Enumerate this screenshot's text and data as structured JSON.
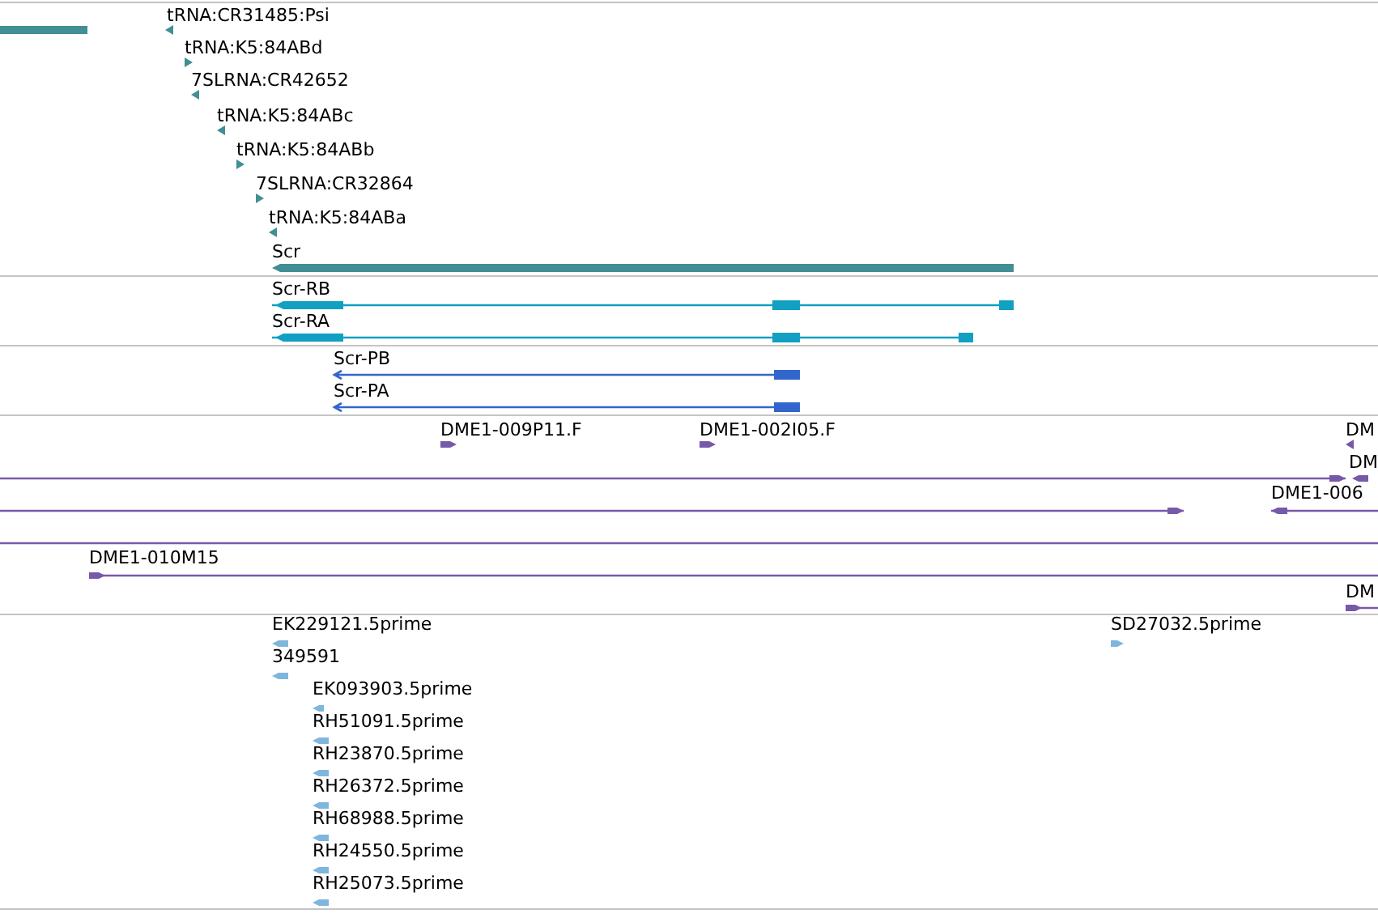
{
  "tracks": [
    {
      "color": "#3f8f94",
      "features": [
        {
          "kind": "bar"
        },
        {
          "kind": "marker",
          "label": "tRNA:CR31485:Psi",
          "reverse": true
        },
        {
          "kind": "marker",
          "label": "tRNA:K5:84ABd",
          "reverse": false
        },
        {
          "kind": "marker",
          "label": "7SLRNA:CR42652",
          "reverse": true
        },
        {
          "kind": "marker",
          "label": "tRNA:K5:84ABc",
          "reverse": true
        },
        {
          "kind": "marker",
          "label": "tRNA:K5:84ABb",
          "reverse": false
        },
        {
          "kind": "marker",
          "label": "7SLRNA:CR32864",
          "reverse": false
        },
        {
          "kind": "marker",
          "label": "tRNA:K5:84ABa",
          "reverse": true
        },
        {
          "kind": "bar",
          "label": "Scr",
          "reverse": true
        }
      ]
    },
    {
      "color": "#11a0c2",
      "features": [
        {
          "kind": "transcript",
          "label": "Scr-RB",
          "reverse": true
        },
        {
          "kind": "transcript",
          "label": "Scr-RA",
          "reverse": true
        }
      ]
    },
    {
      "color": "#3366cc",
      "features": [
        {
          "kind": "transcript",
          "label": "Scr-PB",
          "reverse": true
        },
        {
          "kind": "transcript",
          "label": "Scr-PA",
          "reverse": true
        }
      ]
    },
    {
      "color": "#7759aa",
      "features": [
        {
          "kind": "marker",
          "label": "DME1-009P11.F",
          "reverse": false
        },
        {
          "kind": "marker",
          "label": "DME1-002I05.F",
          "reverse": false
        },
        {
          "kind": "marker",
          "label": "DM",
          "reverse": true
        },
        {
          "kind": "line",
          "reverse": false
        },
        {
          "kind": "marker",
          "label": "DM",
          "reverse": true
        },
        {
          "kind": "line",
          "reverse": false
        },
        {
          "kind": "line",
          "label": "DME1-006",
          "reverse": true
        },
        {
          "kind": "line"
        },
        {
          "kind": "line",
          "label": "DME1-010M15",
          "reverse": false
        },
        {
          "kind": "line",
          "label": "DM",
          "reverse": false
        }
      ]
    },
    {
      "color": "#7fb6dc",
      "features": [
        {
          "kind": "marker",
          "label": "EK229121.5prime",
          "reverse": true
        },
        {
          "kind": "marker",
          "label": "SD27032.5prime",
          "reverse": false
        },
        {
          "kind": "marker",
          "label": "349591",
          "reverse": true
        },
        {
          "kind": "marker",
          "label": "EK093903.5prime",
          "reverse": true
        },
        {
          "kind": "marker",
          "label": "RH51091.5prime",
          "reverse": true
        },
        {
          "kind": "marker",
          "label": "RH23870.5prime",
          "reverse": true
        },
        {
          "kind": "marker",
          "label": "RH26372.5prime",
          "reverse": true
        },
        {
          "kind": "marker",
          "label": "RH68988.5prime",
          "reverse": true
        },
        {
          "kind": "marker",
          "label": "RH24550.5prime",
          "reverse": true
        },
        {
          "kind": "marker",
          "label": "RH25073.5prime",
          "reverse": true
        }
      ]
    }
  ]
}
